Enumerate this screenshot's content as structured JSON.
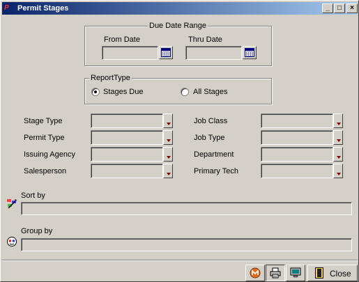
{
  "window": {
    "title": "Permit Stages",
    "app_icon": "permit-app-icon",
    "controls": {
      "minimize": "_",
      "maximize": "□",
      "close": "×"
    }
  },
  "due_date_range": {
    "legend": "Due Date Range",
    "from_label": "From Date",
    "from_value": "",
    "thru_label": "Thru Date",
    "thru_value": "",
    "calendar_icon": "calendar-icon"
  },
  "report_type": {
    "legend": "ReportType",
    "options": [
      {
        "label": "Stages Due",
        "selected": true
      },
      {
        "label": "All Stages",
        "selected": false
      }
    ]
  },
  "filters": {
    "left": [
      {
        "label": "Stage Type",
        "value": ""
      },
      {
        "label": "Permit Type",
        "value": ""
      },
      {
        "label": "Issuing Agency",
        "value": ""
      },
      {
        "label": "Salesperson",
        "value": ""
      }
    ],
    "right": [
      {
        "label": "Job Class",
        "value": ""
      },
      {
        "label": "Job Type",
        "value": ""
      },
      {
        "label": "Department",
        "value": ""
      },
      {
        "label": "Primary Tech",
        "value": ""
      }
    ]
  },
  "sort_by": {
    "label": "Sort by",
    "value": "",
    "icon": "sort-icon"
  },
  "group_by": {
    "label": "Group by",
    "value": "",
    "icon": "group-icon"
  },
  "toolbar": {
    "buttons": [
      {
        "name": "merge-button",
        "icon": "merge-icon"
      },
      {
        "name": "print-button",
        "icon": "printer-icon",
        "pressed": true
      },
      {
        "name": "preview-button",
        "icon": "monitor-icon"
      }
    ],
    "close_label": "Close",
    "close_icon": "door-icon"
  }
}
